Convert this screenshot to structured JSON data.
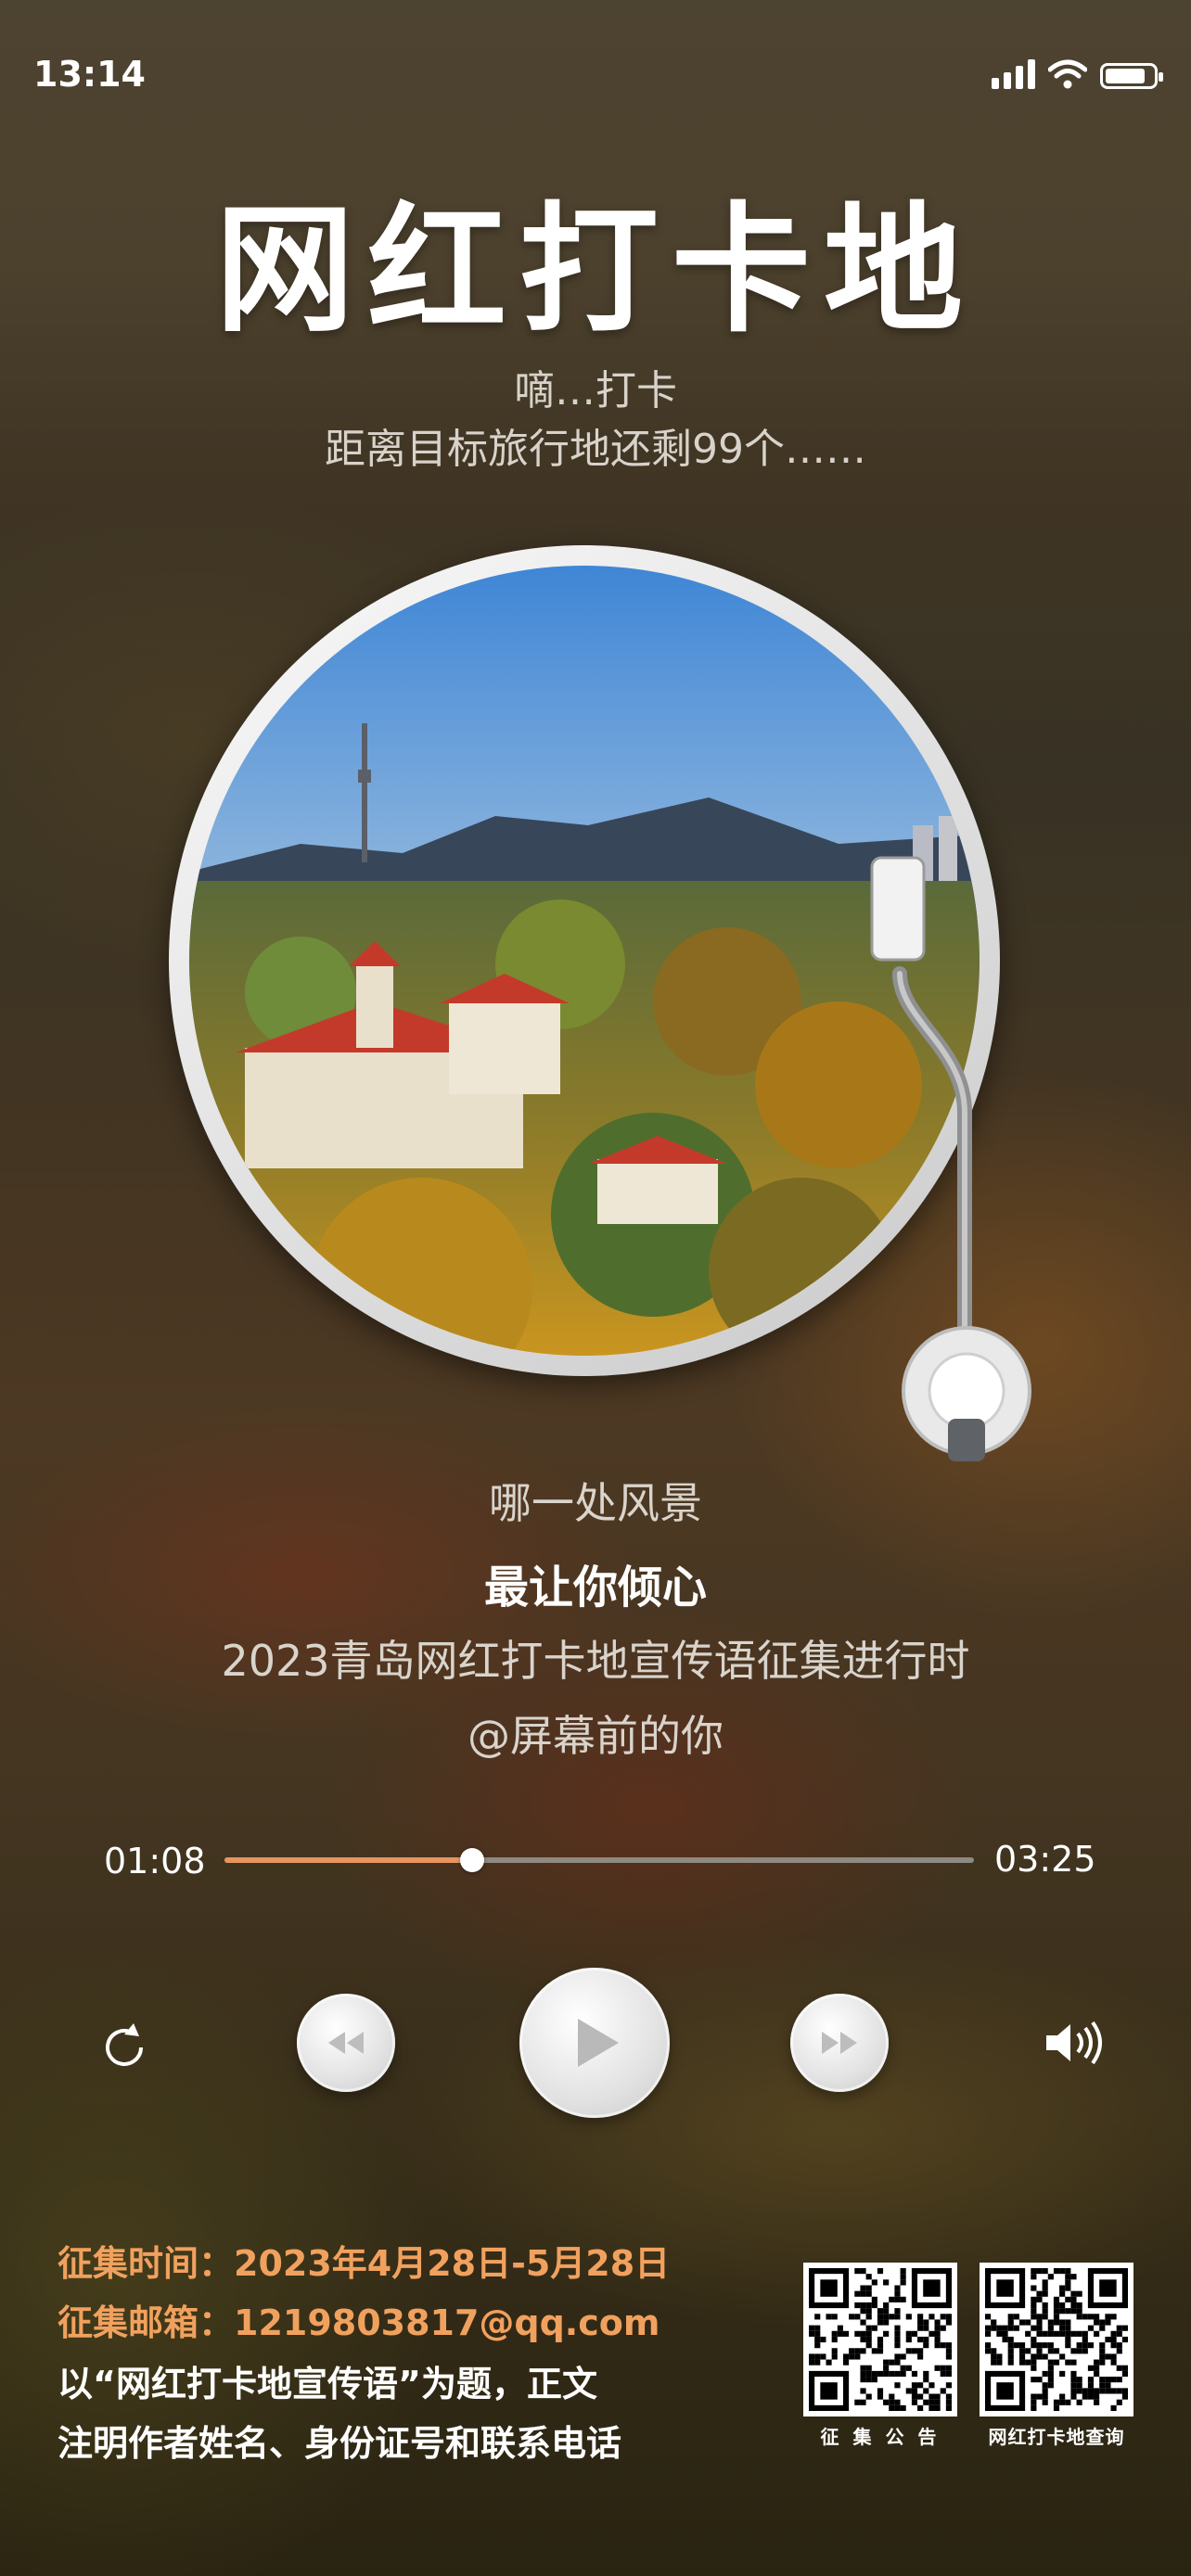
{
  "status_bar": {
    "time": "13:14",
    "icons": [
      "signal-icon",
      "wifi-icon",
      "battery-icon"
    ]
  },
  "header": {
    "title": "网红打卡地",
    "subtitle_line1": "嘀…打卡",
    "subtitle_line2": "距离目标旅行地还剩99个……"
  },
  "lyrics": {
    "line1": "哪一处风景",
    "line2": "最让你倾心",
    "line3": "2023青岛网红打卡地宣传语征集进行时",
    "line4": "@屏幕前的你"
  },
  "player": {
    "current_time": "01:08",
    "total_time": "03:25",
    "progress_fraction": 0.33,
    "controls": [
      "repeat-icon",
      "rewind-icon",
      "play-icon",
      "fast-forward-icon",
      "volume-icon"
    ],
    "accent_color": "#e69560"
  },
  "footer": {
    "period": "征集时间：2023年4月28日-5月28日",
    "email": "征集邮箱：1219803817@qq.com",
    "note_line1": "以“网红打卡地宣传语”为题，正文",
    "note_line2": "注明作者姓名、身份证号和联系电话",
    "highlight_color": "#f1a15e",
    "qr_codes": [
      {
        "caption": "征 集 公 告"
      },
      {
        "caption": "网红打卡地查询"
      }
    ]
  }
}
